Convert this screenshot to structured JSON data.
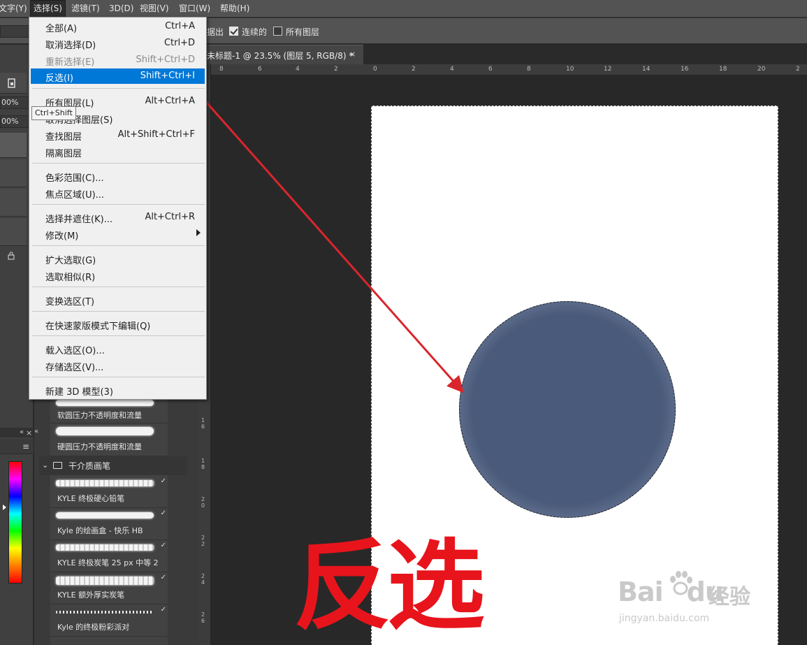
{
  "menubar": {
    "items": [
      "文字(Y)",
      "选择(S)",
      "滤镜(T)",
      "3D(D)",
      "视图(V)",
      "窗口(W)",
      "帮助(H)"
    ],
    "active": "选择(S)"
  },
  "options": {
    "partial_label": "据出",
    "contiguous_label": "连续的",
    "contiguous_checked": true,
    "all_layers_label": "所有图层",
    "all_layers_checked": false
  },
  "left_panel": {
    "zoom1": "00%",
    "zoom2": "00%"
  },
  "document": {
    "tab_title": "未标题-1 @ 23.5% (图层 5, RGB/8) *",
    "close_glyph": "×"
  },
  "ruler": {
    "h_ticks": [
      "8",
      "6",
      "4",
      "2",
      "0",
      "2",
      "4",
      "6",
      "8",
      "10",
      "12",
      "14",
      "16",
      "18",
      "20",
      "2"
    ],
    "v_ticks": [
      "1\n6",
      "1\n8",
      "2\n0",
      "2\n2",
      "2\n4",
      "2\n6"
    ]
  },
  "select_menu": {
    "items": [
      {
        "label": "全部(A)",
        "shortcut": "Ctrl+A",
        "state": "normal"
      },
      {
        "label": "取消选择(D)",
        "shortcut": "Ctrl+D",
        "state": "normal"
      },
      {
        "label": "重新选择(E)",
        "shortcut": "Shift+Ctrl+D",
        "state": "disabled"
      },
      {
        "label": "反选(I)",
        "shortcut": "Shift+Ctrl+I",
        "state": "highlight"
      },
      {
        "label": "所有图层(L)",
        "shortcut": "Alt+Ctrl+A",
        "state": "normal"
      },
      {
        "label": "取消选择图层(S)",
        "shortcut": "",
        "state": "normal"
      },
      {
        "label": "查找图层",
        "shortcut": "Alt+Shift+Ctrl+F",
        "state": "normal"
      },
      {
        "label": "隔离图层",
        "shortcut": "",
        "state": "normal"
      },
      {
        "label": "色彩范围(C)...",
        "shortcut": "",
        "state": "normal"
      },
      {
        "label": "焦点区域(U)...",
        "shortcut": "",
        "state": "normal"
      },
      {
        "label": "选择并遮住(K)...",
        "shortcut": "Alt+Ctrl+R",
        "state": "normal"
      },
      {
        "label": "修改(M)",
        "shortcut": "",
        "state": "submenu"
      },
      {
        "label": "扩大选取(G)",
        "shortcut": "",
        "state": "normal"
      },
      {
        "label": "选取相似(R)",
        "shortcut": "",
        "state": "normal"
      },
      {
        "label": "变换选区(T)",
        "shortcut": "",
        "state": "normal"
      },
      {
        "label": "在快速蒙版模式下编辑(Q)",
        "shortcut": "",
        "state": "normal"
      },
      {
        "label": "载入选区(O)...",
        "shortcut": "",
        "state": "normal"
      },
      {
        "label": "存储选区(V)...",
        "shortcut": "",
        "state": "normal"
      },
      {
        "label": "新建 3D 模型(3)",
        "shortcut": "",
        "state": "normal"
      }
    ],
    "tooltip": "Ctrl+Shift"
  },
  "brushes": {
    "group_label": "干介质画笔",
    "items": [
      {
        "label": "软圆压力不透明度和流量",
        "style": "soft"
      },
      {
        "label": "硬圆压力不透明度和流量",
        "style": "hard"
      },
      {
        "label": "KYLE 终极硬心铅笔",
        "style": "rough"
      },
      {
        "label": "Kyle 的绘画盒 - 快乐 HB",
        "style": "soft"
      },
      {
        "label": "KYLE 终极炭笔 25 px 中等 2",
        "style": "rough"
      },
      {
        "label": "KYLE 额外厚实炭笔",
        "style": "rough"
      },
      {
        "label": "Kyle 的终极粉彩派对",
        "style": "dots"
      }
    ]
  },
  "canvas": {
    "annotation": "反选",
    "circle_color": "#4a5a7a",
    "accent_color": "#e8141c",
    "arrow_color": "#d9262c"
  },
  "watermark": {
    "brand": "Bai",
    "brand2": "du",
    "cn": "经验",
    "url": "jingyan.baidu.com"
  }
}
